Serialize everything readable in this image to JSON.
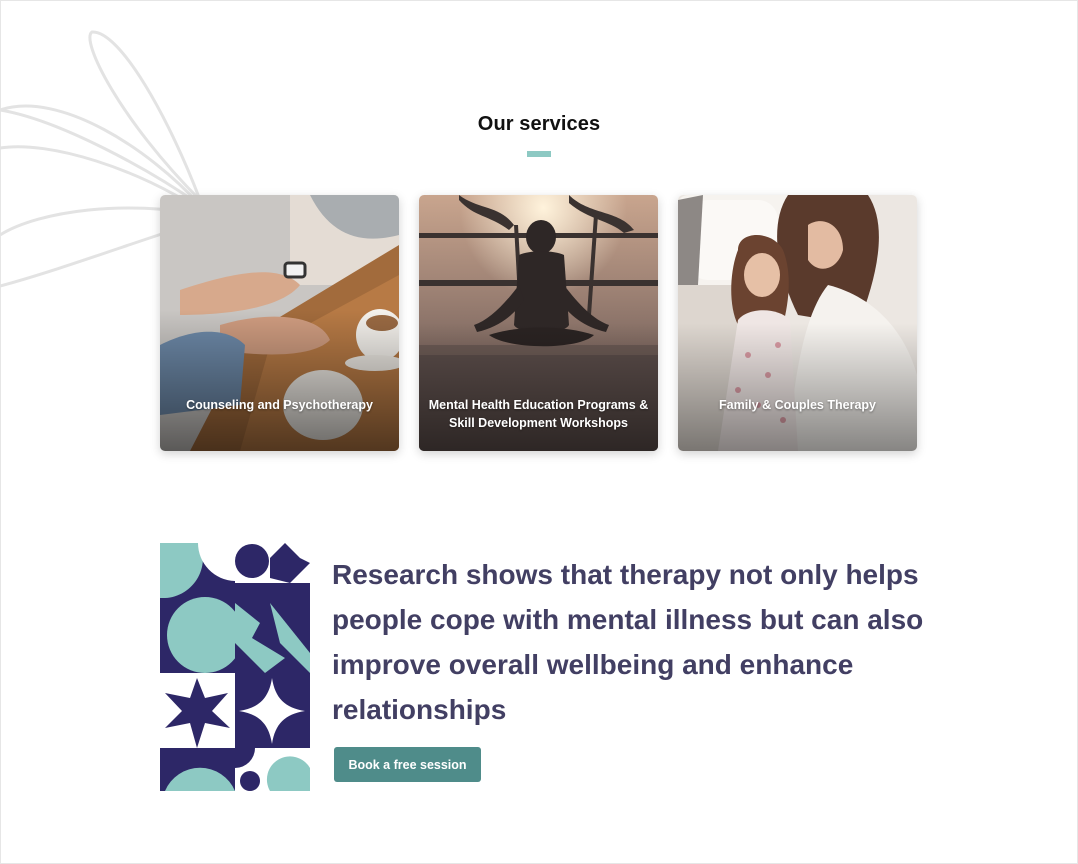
{
  "services": {
    "title": "Our services",
    "cards": [
      {
        "label": "Counseling and Psychotherapy",
        "image": "hands-coffee-photo"
      },
      {
        "label_line1": "Mental Health Education Programs &",
        "label_line2": "Skill Development Workshops",
        "image": "meditation-sunset-photo"
      },
      {
        "label": "Family & Couples Therapy",
        "image": "mother-daughter-photo"
      }
    ]
  },
  "research": {
    "quote": "Research shows that therapy not only helps people cope with mental illness but can also improve overall wellbeing and enhance relationships",
    "button_label": "Book a free session"
  },
  "colors": {
    "accent_teal": "#8dc9c3",
    "button_teal": "#4f8c8a",
    "heading_purple": "#423f63",
    "pattern_navy": "#2d2767"
  }
}
